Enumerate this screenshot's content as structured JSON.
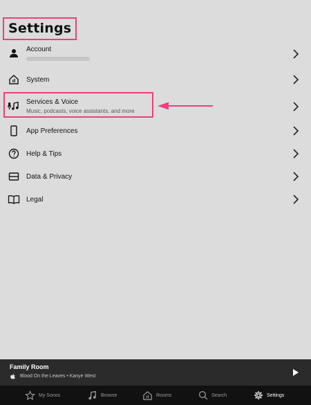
{
  "page": {
    "title": "Settings"
  },
  "settings": {
    "items": [
      {
        "id": "account",
        "label": "Account",
        "icon": "person-icon"
      },
      {
        "id": "system",
        "label": "System",
        "icon": "home-speaker-icon"
      },
      {
        "id": "services",
        "label": "Services & Voice",
        "sublabel": "Music, podcasts, voice assistants, and more",
        "icon": "mic-music-icon"
      },
      {
        "id": "app-preferences",
        "label": "App Preferences",
        "icon": "phone-icon"
      },
      {
        "id": "help",
        "label": "Help & Tips",
        "icon": "question-circle-icon"
      },
      {
        "id": "data",
        "label": "Data & Privacy",
        "icon": "database-icon"
      },
      {
        "id": "legal",
        "label": "Legal",
        "icon": "book-icon"
      }
    ]
  },
  "now_playing": {
    "room": "Family Room",
    "track": "Blood On the Leaves • Kanye West",
    "source_icon": "apple-logo-icon",
    "control_icon": "play-icon"
  },
  "tabs": [
    {
      "label": "My Sonos",
      "icon": "star-icon",
      "active": false
    },
    {
      "label": "Browse",
      "icon": "music-note-icon",
      "active": false
    },
    {
      "label": "Rooms",
      "icon": "rooms-icon",
      "active": false
    },
    {
      "label": "Search",
      "icon": "search-icon",
      "active": false
    },
    {
      "label": "Settings",
      "icon": "gear-icon",
      "active": true
    }
  ],
  "annotation": {
    "highlight_color": "#ec3f7d"
  }
}
